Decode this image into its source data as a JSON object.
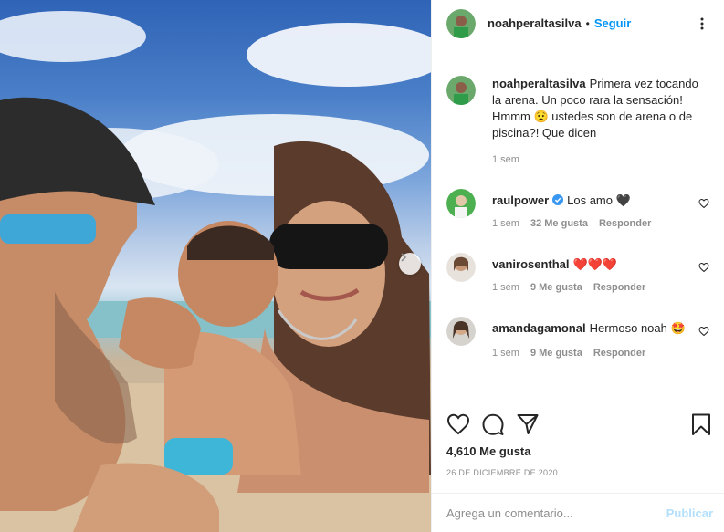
{
  "post": {
    "author": "noahperaltasilva",
    "follow_label": "Seguir",
    "separator": "•",
    "caption": "Primera vez tocando la arena. Un poco rara la sensación! Hmmm 😟 ustedes son de arena o de piscina?! Que dicen",
    "caption_time": "1 sem",
    "likes": "4,610 Me gusta",
    "date": "26 DE DICIEMBRE DE 2020"
  },
  "comments": [
    {
      "user": "raulpower",
      "verified": true,
      "text": "Los amo 🖤",
      "time": "1 sem",
      "likes": "32 Me gusta",
      "reply": "Responder"
    },
    {
      "user": "vanirosenthal",
      "verified": false,
      "text": "❤️❤️❤️",
      "time": "1 sem",
      "likes": "9 Me gusta",
      "reply": "Responder"
    },
    {
      "user": "amandagamonal",
      "verified": false,
      "text": "Hermoso noah 🤩",
      "time": "1 sem",
      "likes": "9 Me gusta",
      "reply": "Responder"
    }
  ],
  "composer": {
    "placeholder": "Agrega un comentario...",
    "publish_label": "Publicar"
  },
  "icons": {
    "more": "more-options-icon",
    "next": "chevron-right-icon",
    "like": "heart-icon",
    "comment": "comment-icon",
    "share": "share-icon",
    "save": "bookmark-icon"
  },
  "colors": {
    "accent": "#0095f6",
    "publish_disabled": "#b2dffc",
    "text": "#262626",
    "muted": "#8e8e8e",
    "border": "#efefef"
  }
}
